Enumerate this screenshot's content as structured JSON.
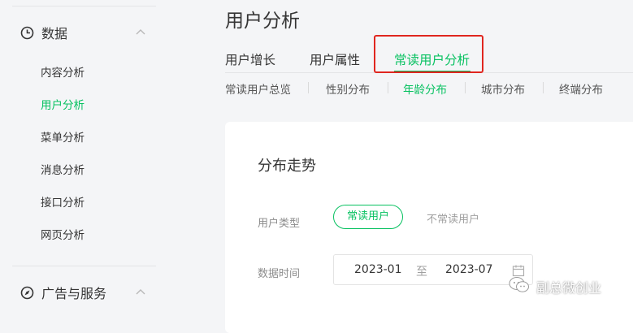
{
  "sidebar": {
    "sections": [
      {
        "label": "数据",
        "icon": "clock-icon"
      },
      {
        "label": "广告与服务",
        "icon": "compass-icon"
      }
    ],
    "items": [
      {
        "label": "内容分析",
        "active": false
      },
      {
        "label": "用户分析",
        "active": true
      },
      {
        "label": "菜单分析",
        "active": false
      },
      {
        "label": "消息分析",
        "active": false
      },
      {
        "label": "接口分析",
        "active": false
      },
      {
        "label": "网页分析",
        "active": false
      }
    ]
  },
  "page": {
    "title": "用户分析"
  },
  "tabs": [
    {
      "label": "用户增长",
      "active": false
    },
    {
      "label": "用户属性",
      "active": false
    },
    {
      "label": "常读用户分析",
      "active": true
    }
  ],
  "subtabs": [
    {
      "label": "常读用户总览",
      "active": false
    },
    {
      "label": "性别分布",
      "active": false
    },
    {
      "label": "年龄分布",
      "active": true
    },
    {
      "label": "城市分布",
      "active": false
    },
    {
      "label": "终端分布",
      "active": false
    }
  ],
  "card": {
    "title": "分布走势",
    "user_type_label": "用户类型",
    "user_type_options": [
      "常读用户",
      "不常读用户"
    ],
    "date_label": "数据时间",
    "date_start": "2023-01",
    "date_sep": "至",
    "date_end": "2023-07"
  },
  "watermark": {
    "text": "副总微创业",
    "icon": "wechat-icon"
  },
  "colors": {
    "accent": "#07c160",
    "highlight": "#e0261f",
    "text": "#353535",
    "muted": "#8c8c8c"
  }
}
